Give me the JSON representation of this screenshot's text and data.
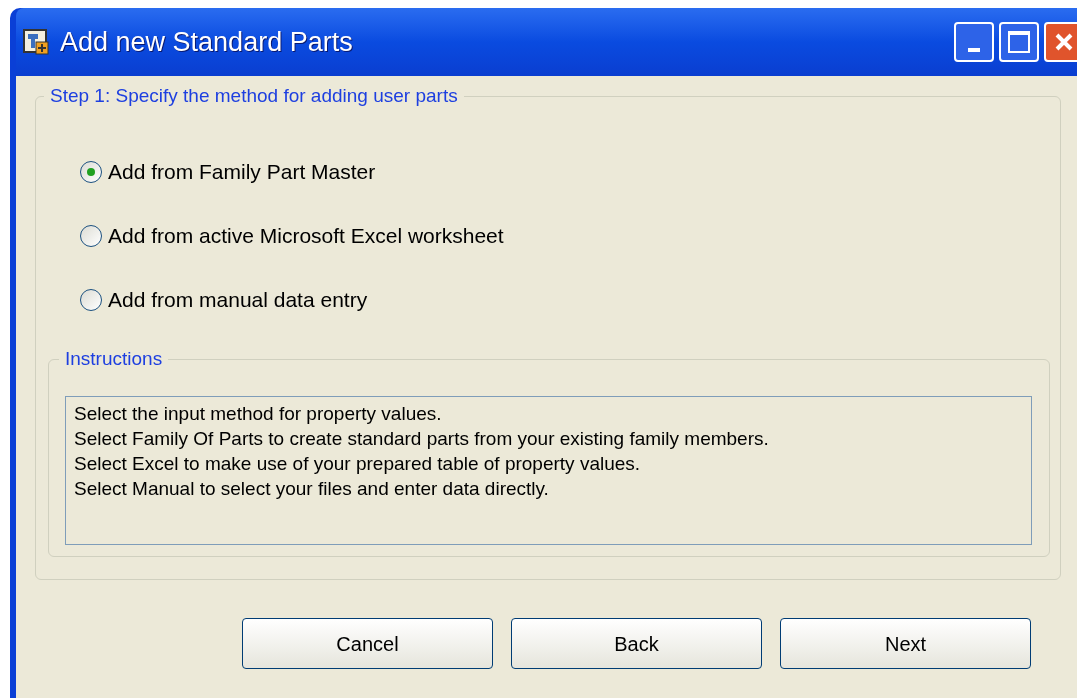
{
  "window": {
    "title": "Add new Standard Parts"
  },
  "step": {
    "legend": "Step 1: Specify the method for adding user parts",
    "options": [
      {
        "label": "Add from Family Part Master",
        "selected": true
      },
      {
        "label": "Add from active Microsoft Excel worksheet",
        "selected": false
      },
      {
        "label": "Add from manual data entry",
        "selected": false
      }
    ]
  },
  "instructions": {
    "legend": "Instructions",
    "lines": [
      "Select the input method for property values.",
      "Select Family Of Parts to create standard parts from your existing family members.",
      "Select Excel to make use of your prepared table of property values.",
      "Select Manual to select your files and enter data directly."
    ]
  },
  "buttons": [
    "Cancel",
    "Back",
    "Next"
  ]
}
